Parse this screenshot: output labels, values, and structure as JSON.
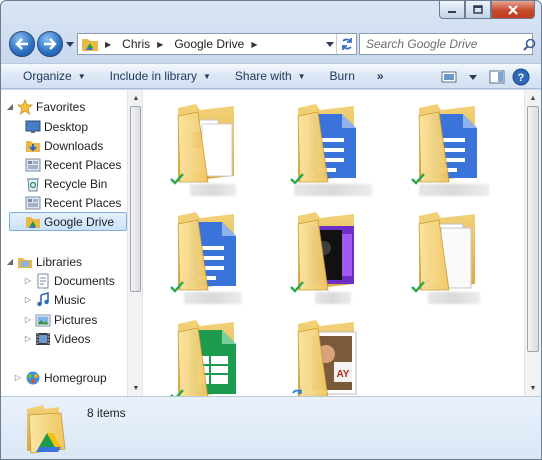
{
  "window": {
    "buttons": {
      "minimize": "minimize-icon",
      "maximize": "maximize-icon",
      "close": "close-icon"
    }
  },
  "address": {
    "crumbs": [
      {
        "label": "Chris"
      },
      {
        "label": "Google Drive"
      }
    ],
    "search_placeholder": "Search Google Drive"
  },
  "commands": {
    "organize": "Organize",
    "include_in_library": "Include in library",
    "share_with": "Share with",
    "burn": "Burn",
    "more": "»"
  },
  "nav": {
    "favorites_label": "Favorites",
    "favorites": [
      {
        "label": "Desktop",
        "icon": "desktop-icon"
      },
      {
        "label": "Downloads",
        "icon": "downloads-icon"
      },
      {
        "label": "Recent Places",
        "icon": "recent-places-icon"
      },
      {
        "label": "Recycle Bin",
        "icon": "recycle-bin-icon"
      },
      {
        "label": "Recent Places",
        "icon": "recent-places-icon"
      },
      {
        "label": "Google Drive",
        "icon": "google-drive-icon",
        "selected": true
      }
    ],
    "libraries_label": "Libraries",
    "libraries": [
      {
        "label": "Documents",
        "icon": "documents-icon"
      },
      {
        "label": "Music",
        "icon": "music-icon"
      },
      {
        "label": "Pictures",
        "icon": "pictures-icon"
      },
      {
        "label": "Videos",
        "icon": "videos-icon"
      }
    ],
    "homegroup_label": "Homegroup"
  },
  "files": [
    {
      "content": "red-document",
      "status": "synced-check"
    },
    {
      "content": "google-doc",
      "status": "synced-check"
    },
    {
      "content": "google-doc",
      "status": "synced-check"
    },
    {
      "content": "google-doc",
      "status": "synced-check"
    },
    {
      "content": "video-thumbnail",
      "status": "synced-check"
    },
    {
      "content": "blank-pages",
      "status": "synced-check"
    },
    {
      "content": "google-sheet",
      "status": "synced-check"
    },
    {
      "content": "photo-thumbnail",
      "status": "syncing-arrows"
    }
  ],
  "details": {
    "count_text": "8 items"
  },
  "colors": {
    "folder": "#f2c75c",
    "google_blue": "#3a73d9",
    "google_green": "#1c9a4e",
    "check_green": "#2aa64e",
    "selection": "#c9e2fb"
  }
}
